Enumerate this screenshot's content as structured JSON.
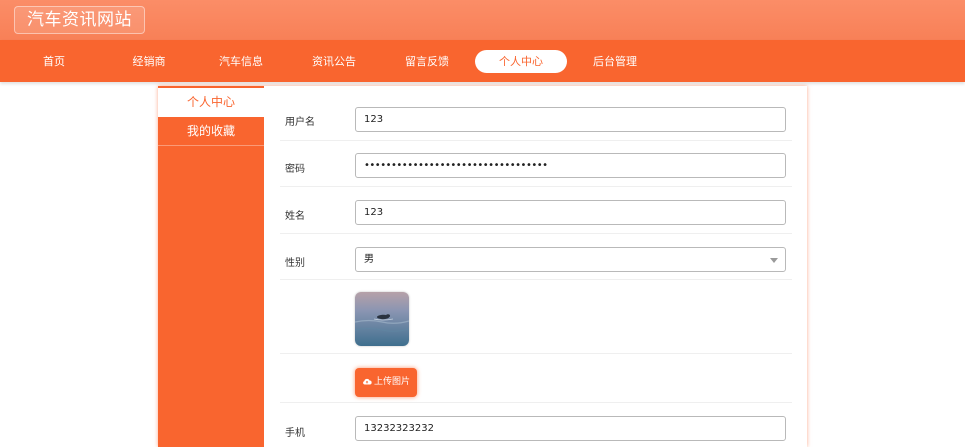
{
  "site": {
    "title": "汽车资讯网站"
  },
  "nav": {
    "items": [
      {
        "label": "首页"
      },
      {
        "label": "经销商"
      },
      {
        "label": "汽车信息"
      },
      {
        "label": "资讯公告"
      },
      {
        "label": "留言反馈"
      },
      {
        "label": "个人中心",
        "active": true
      },
      {
        "label": "后台管理"
      }
    ]
  },
  "sidebar": {
    "items": [
      {
        "label": "个人中心",
        "active": true
      },
      {
        "label": "我的收藏"
      }
    ]
  },
  "form": {
    "username": {
      "label": "用户名",
      "value": "123"
    },
    "password": {
      "label": "密码",
      "value": "••••••••••••••••••••••••••••••••••"
    },
    "name": {
      "label": "姓名",
      "value": "123"
    },
    "gender": {
      "label": "性别",
      "value": "男"
    },
    "upload": {
      "label": "上传图片",
      "icon": "cloud-upload-icon"
    },
    "phone": {
      "label": "手机",
      "value": "13232323232"
    }
  },
  "colors": {
    "brand": "#f9652f",
    "topbar": "#fb8d67"
  }
}
